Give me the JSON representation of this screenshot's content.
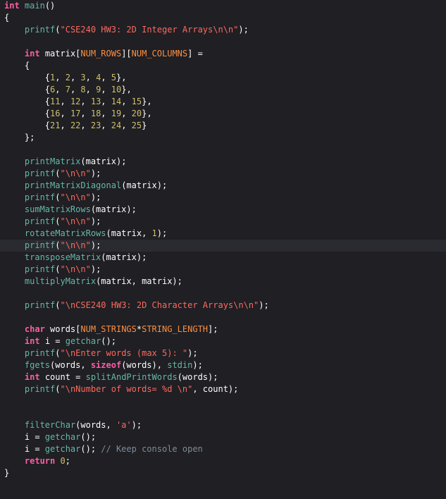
{
  "editor": {
    "language": "c",
    "highlighted_line": 20,
    "colors": {
      "background": "#1f1f24",
      "current_line": "#2a2b30",
      "keyword": "#fc5fa3",
      "function": "#67b7a4",
      "string": "#fc6a5d",
      "number": "#d0bf69",
      "macro": "#fd8f3f",
      "comment": "#7f8c98",
      "plain": "#ffffff"
    },
    "lines": [
      [
        [
          "kw",
          "int"
        ],
        [
          "p",
          " "
        ],
        [
          "fn",
          "main"
        ],
        [
          "p",
          "()"
        ]
      ],
      [
        [
          "p",
          "{"
        ]
      ],
      [
        [
          "p",
          "    "
        ],
        [
          "fn",
          "printf"
        ],
        [
          "p",
          "("
        ],
        [
          "str",
          "\"CSE240 HW3: 2D Integer Arrays\\n\\n\""
        ],
        [
          "p",
          ");"
        ]
      ],
      [],
      [
        [
          "p",
          "    "
        ],
        [
          "kw",
          "int"
        ],
        [
          "p",
          " matrix["
        ],
        [
          "mc",
          "NUM_ROWS"
        ],
        [
          "p",
          "]["
        ],
        [
          "mc",
          "NUM_COLUMNS"
        ],
        [
          "p",
          "] ="
        ]
      ],
      [
        [
          "p",
          "    {"
        ]
      ],
      [
        [
          "p",
          "        {"
        ],
        [
          "num",
          "1"
        ],
        [
          "p",
          ", "
        ],
        [
          "num",
          "2"
        ],
        [
          "p",
          ", "
        ],
        [
          "num",
          "3"
        ],
        [
          "p",
          ", "
        ],
        [
          "num",
          "4"
        ],
        [
          "p",
          ", "
        ],
        [
          "num",
          "5"
        ],
        [
          "p",
          "},"
        ]
      ],
      [
        [
          "p",
          "        {"
        ],
        [
          "num",
          "6"
        ],
        [
          "p",
          ", "
        ],
        [
          "num",
          "7"
        ],
        [
          "p",
          ", "
        ],
        [
          "num",
          "8"
        ],
        [
          "p",
          ", "
        ],
        [
          "num",
          "9"
        ],
        [
          "p",
          ", "
        ],
        [
          "num",
          "10"
        ],
        [
          "p",
          "},"
        ]
      ],
      [
        [
          "p",
          "        {"
        ],
        [
          "num",
          "11"
        ],
        [
          "p",
          ", "
        ],
        [
          "num",
          "12"
        ],
        [
          "p",
          ", "
        ],
        [
          "num",
          "13"
        ],
        [
          "p",
          ", "
        ],
        [
          "num",
          "14"
        ],
        [
          "p",
          ", "
        ],
        [
          "num",
          "15"
        ],
        [
          "p",
          "},"
        ]
      ],
      [
        [
          "p",
          "        {"
        ],
        [
          "num",
          "16"
        ],
        [
          "p",
          ", "
        ],
        [
          "num",
          "17"
        ],
        [
          "p",
          ", "
        ],
        [
          "num",
          "18"
        ],
        [
          "p",
          ", "
        ],
        [
          "num",
          "19"
        ],
        [
          "p",
          ", "
        ],
        [
          "num",
          "20"
        ],
        [
          "p",
          "},"
        ]
      ],
      [
        [
          "p",
          "        {"
        ],
        [
          "num",
          "21"
        ],
        [
          "p",
          ", "
        ],
        [
          "num",
          "22"
        ],
        [
          "p",
          ", "
        ],
        [
          "num",
          "23"
        ],
        [
          "p",
          ", "
        ],
        [
          "num",
          "24"
        ],
        [
          "p",
          ", "
        ],
        [
          "num",
          "25"
        ],
        [
          "p",
          "}"
        ]
      ],
      [
        [
          "p",
          "    };"
        ]
      ],
      [],
      [
        [
          "p",
          "    "
        ],
        [
          "fn",
          "printMatrix"
        ],
        [
          "p",
          "(matrix);"
        ]
      ],
      [
        [
          "p",
          "    "
        ],
        [
          "fn",
          "printf"
        ],
        [
          "p",
          "("
        ],
        [
          "str",
          "\"\\n\\n\""
        ],
        [
          "p",
          ");"
        ]
      ],
      [
        [
          "p",
          "    "
        ],
        [
          "fn",
          "printMatrixDiagonal"
        ],
        [
          "p",
          "(matrix);"
        ]
      ],
      [
        [
          "p",
          "    "
        ],
        [
          "fn",
          "printf"
        ],
        [
          "p",
          "("
        ],
        [
          "str",
          "\"\\n\\n\""
        ],
        [
          "p",
          ");"
        ]
      ],
      [
        [
          "p",
          "    "
        ],
        [
          "fn",
          "sumMatrixRows"
        ],
        [
          "p",
          "(matrix);"
        ]
      ],
      [
        [
          "p",
          "    "
        ],
        [
          "fn",
          "printf"
        ],
        [
          "p",
          "("
        ],
        [
          "str",
          "\"\\n\\n\""
        ],
        [
          "p",
          ");"
        ]
      ],
      [
        [
          "p",
          "    "
        ],
        [
          "fn",
          "rotateMatrixRows"
        ],
        [
          "p",
          "(matrix, "
        ],
        [
          "num",
          "1"
        ],
        [
          "p",
          ");"
        ]
      ],
      [
        [
          "p",
          "    "
        ],
        [
          "fn",
          "printf"
        ],
        [
          "p",
          "("
        ],
        [
          "str",
          "\"\\n\\n\""
        ],
        [
          "p",
          ");"
        ]
      ],
      [
        [
          "p",
          "    "
        ],
        [
          "fn",
          "transposeMatrix"
        ],
        [
          "p",
          "(matrix);"
        ]
      ],
      [
        [
          "p",
          "    "
        ],
        [
          "fn",
          "printf"
        ],
        [
          "p",
          "("
        ],
        [
          "str",
          "\"\\n\\n\""
        ],
        [
          "p",
          ");"
        ]
      ],
      [
        [
          "p",
          "    "
        ],
        [
          "fn",
          "multiplyMatrix"
        ],
        [
          "p",
          "(matrix, matrix);"
        ]
      ],
      [],
      [
        [
          "p",
          "    "
        ],
        [
          "fn",
          "printf"
        ],
        [
          "p",
          "("
        ],
        [
          "str",
          "\"\\nCSE240 HW3: 2D Character Arrays\\n\\n\""
        ],
        [
          "p",
          ");"
        ]
      ],
      [],
      [
        [
          "p",
          "    "
        ],
        [
          "kw",
          "char"
        ],
        [
          "p",
          " words["
        ],
        [
          "mc",
          "NUM_STRINGS"
        ],
        [
          "p",
          "*"
        ],
        [
          "mc",
          "STRING_LENGTH"
        ],
        [
          "p",
          "];"
        ]
      ],
      [
        [
          "p",
          "    "
        ],
        [
          "kw",
          "int"
        ],
        [
          "p",
          " i = "
        ],
        [
          "fn",
          "getchar"
        ],
        [
          "p",
          "();"
        ]
      ],
      [
        [
          "p",
          "    "
        ],
        [
          "fn",
          "printf"
        ],
        [
          "p",
          "("
        ],
        [
          "str",
          "\"\\nEnter words (max 5): \""
        ],
        [
          "p",
          ");"
        ]
      ],
      [
        [
          "p",
          "    "
        ],
        [
          "fn",
          "fgets"
        ],
        [
          "p",
          "(words, "
        ],
        [
          "kw",
          "sizeof"
        ],
        [
          "p",
          "(words), "
        ],
        [
          "fn",
          "stdin"
        ],
        [
          "p",
          ");"
        ]
      ],
      [
        [
          "p",
          "    "
        ],
        [
          "kw",
          "int"
        ],
        [
          "p",
          " count = "
        ],
        [
          "fn",
          "splitAndPrintWords"
        ],
        [
          "p",
          "(words);"
        ]
      ],
      [
        [
          "p",
          "    "
        ],
        [
          "fn",
          "printf"
        ],
        [
          "p",
          "("
        ],
        [
          "str",
          "\"\\nNumber of words= %d \\n\""
        ],
        [
          "p",
          ", count);"
        ]
      ],
      [],
      [],
      [
        [
          "p",
          "    "
        ],
        [
          "fn",
          "filterChar"
        ],
        [
          "p",
          "(words, "
        ],
        [
          "str",
          "'a'"
        ],
        [
          "p",
          ");"
        ]
      ],
      [
        [
          "p",
          "    i = "
        ],
        [
          "fn",
          "getchar"
        ],
        [
          "p",
          "();"
        ]
      ],
      [
        [
          "p",
          "    i = "
        ],
        [
          "fn",
          "getchar"
        ],
        [
          "p",
          "(); "
        ],
        [
          "cm",
          "// Keep console open"
        ]
      ],
      [
        [
          "p",
          "    "
        ],
        [
          "kw",
          "return"
        ],
        [
          "p",
          " "
        ],
        [
          "num",
          "0"
        ],
        [
          "p",
          ";"
        ]
      ],
      [
        [
          "p",
          "}"
        ]
      ]
    ]
  }
}
